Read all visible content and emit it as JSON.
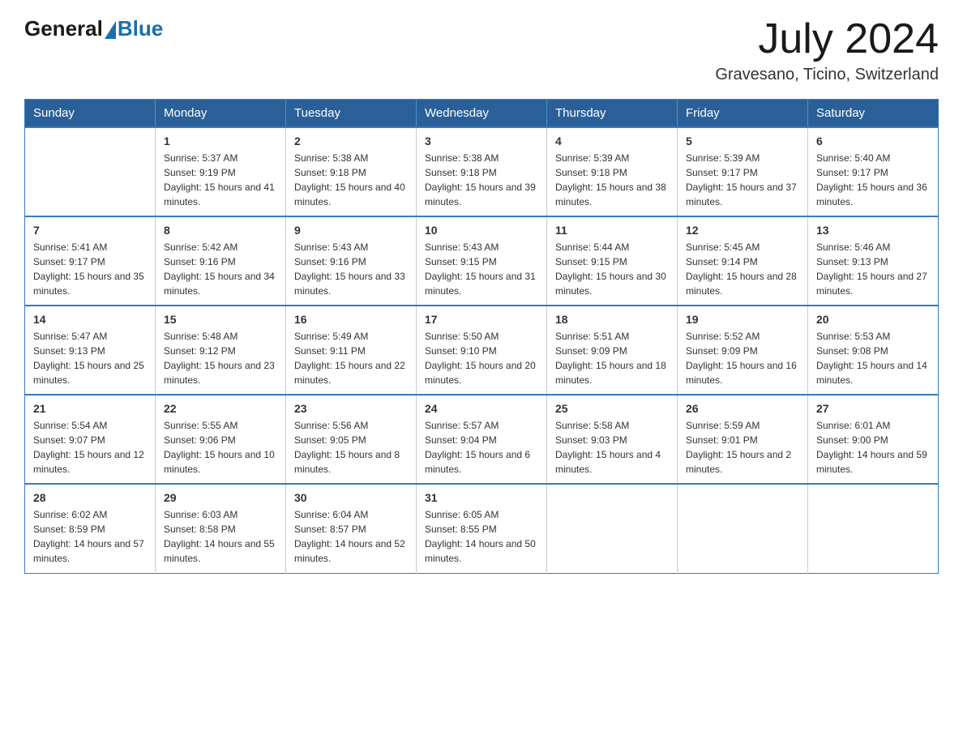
{
  "header": {
    "logo_general": "General",
    "logo_blue": "Blue",
    "main_title": "July 2024",
    "subtitle": "Gravesano, Ticino, Switzerland"
  },
  "weekdays": [
    "Sunday",
    "Monday",
    "Tuesday",
    "Wednesday",
    "Thursday",
    "Friday",
    "Saturday"
  ],
  "weeks": [
    [
      {
        "day": "",
        "sunrise": "",
        "sunset": "",
        "daylight": ""
      },
      {
        "day": "1",
        "sunrise": "Sunrise: 5:37 AM",
        "sunset": "Sunset: 9:19 PM",
        "daylight": "Daylight: 15 hours and 41 minutes."
      },
      {
        "day": "2",
        "sunrise": "Sunrise: 5:38 AM",
        "sunset": "Sunset: 9:18 PM",
        "daylight": "Daylight: 15 hours and 40 minutes."
      },
      {
        "day": "3",
        "sunrise": "Sunrise: 5:38 AM",
        "sunset": "Sunset: 9:18 PM",
        "daylight": "Daylight: 15 hours and 39 minutes."
      },
      {
        "day": "4",
        "sunrise": "Sunrise: 5:39 AM",
        "sunset": "Sunset: 9:18 PM",
        "daylight": "Daylight: 15 hours and 38 minutes."
      },
      {
        "day": "5",
        "sunrise": "Sunrise: 5:39 AM",
        "sunset": "Sunset: 9:17 PM",
        "daylight": "Daylight: 15 hours and 37 minutes."
      },
      {
        "day": "6",
        "sunrise": "Sunrise: 5:40 AM",
        "sunset": "Sunset: 9:17 PM",
        "daylight": "Daylight: 15 hours and 36 minutes."
      }
    ],
    [
      {
        "day": "7",
        "sunrise": "Sunrise: 5:41 AM",
        "sunset": "Sunset: 9:17 PM",
        "daylight": "Daylight: 15 hours and 35 minutes."
      },
      {
        "day": "8",
        "sunrise": "Sunrise: 5:42 AM",
        "sunset": "Sunset: 9:16 PM",
        "daylight": "Daylight: 15 hours and 34 minutes."
      },
      {
        "day": "9",
        "sunrise": "Sunrise: 5:43 AM",
        "sunset": "Sunset: 9:16 PM",
        "daylight": "Daylight: 15 hours and 33 minutes."
      },
      {
        "day": "10",
        "sunrise": "Sunrise: 5:43 AM",
        "sunset": "Sunset: 9:15 PM",
        "daylight": "Daylight: 15 hours and 31 minutes."
      },
      {
        "day": "11",
        "sunrise": "Sunrise: 5:44 AM",
        "sunset": "Sunset: 9:15 PM",
        "daylight": "Daylight: 15 hours and 30 minutes."
      },
      {
        "day": "12",
        "sunrise": "Sunrise: 5:45 AM",
        "sunset": "Sunset: 9:14 PM",
        "daylight": "Daylight: 15 hours and 28 minutes."
      },
      {
        "day": "13",
        "sunrise": "Sunrise: 5:46 AM",
        "sunset": "Sunset: 9:13 PM",
        "daylight": "Daylight: 15 hours and 27 minutes."
      }
    ],
    [
      {
        "day": "14",
        "sunrise": "Sunrise: 5:47 AM",
        "sunset": "Sunset: 9:13 PM",
        "daylight": "Daylight: 15 hours and 25 minutes."
      },
      {
        "day": "15",
        "sunrise": "Sunrise: 5:48 AM",
        "sunset": "Sunset: 9:12 PM",
        "daylight": "Daylight: 15 hours and 23 minutes."
      },
      {
        "day": "16",
        "sunrise": "Sunrise: 5:49 AM",
        "sunset": "Sunset: 9:11 PM",
        "daylight": "Daylight: 15 hours and 22 minutes."
      },
      {
        "day": "17",
        "sunrise": "Sunrise: 5:50 AM",
        "sunset": "Sunset: 9:10 PM",
        "daylight": "Daylight: 15 hours and 20 minutes."
      },
      {
        "day": "18",
        "sunrise": "Sunrise: 5:51 AM",
        "sunset": "Sunset: 9:09 PM",
        "daylight": "Daylight: 15 hours and 18 minutes."
      },
      {
        "day": "19",
        "sunrise": "Sunrise: 5:52 AM",
        "sunset": "Sunset: 9:09 PM",
        "daylight": "Daylight: 15 hours and 16 minutes."
      },
      {
        "day": "20",
        "sunrise": "Sunrise: 5:53 AM",
        "sunset": "Sunset: 9:08 PM",
        "daylight": "Daylight: 15 hours and 14 minutes."
      }
    ],
    [
      {
        "day": "21",
        "sunrise": "Sunrise: 5:54 AM",
        "sunset": "Sunset: 9:07 PM",
        "daylight": "Daylight: 15 hours and 12 minutes."
      },
      {
        "day": "22",
        "sunrise": "Sunrise: 5:55 AM",
        "sunset": "Sunset: 9:06 PM",
        "daylight": "Daylight: 15 hours and 10 minutes."
      },
      {
        "day": "23",
        "sunrise": "Sunrise: 5:56 AM",
        "sunset": "Sunset: 9:05 PM",
        "daylight": "Daylight: 15 hours and 8 minutes."
      },
      {
        "day": "24",
        "sunrise": "Sunrise: 5:57 AM",
        "sunset": "Sunset: 9:04 PM",
        "daylight": "Daylight: 15 hours and 6 minutes."
      },
      {
        "day": "25",
        "sunrise": "Sunrise: 5:58 AM",
        "sunset": "Sunset: 9:03 PM",
        "daylight": "Daylight: 15 hours and 4 minutes."
      },
      {
        "day": "26",
        "sunrise": "Sunrise: 5:59 AM",
        "sunset": "Sunset: 9:01 PM",
        "daylight": "Daylight: 15 hours and 2 minutes."
      },
      {
        "day": "27",
        "sunrise": "Sunrise: 6:01 AM",
        "sunset": "Sunset: 9:00 PM",
        "daylight": "Daylight: 14 hours and 59 minutes."
      }
    ],
    [
      {
        "day": "28",
        "sunrise": "Sunrise: 6:02 AM",
        "sunset": "Sunset: 8:59 PM",
        "daylight": "Daylight: 14 hours and 57 minutes."
      },
      {
        "day": "29",
        "sunrise": "Sunrise: 6:03 AM",
        "sunset": "Sunset: 8:58 PM",
        "daylight": "Daylight: 14 hours and 55 minutes."
      },
      {
        "day": "30",
        "sunrise": "Sunrise: 6:04 AM",
        "sunset": "Sunset: 8:57 PM",
        "daylight": "Daylight: 14 hours and 52 minutes."
      },
      {
        "day": "31",
        "sunrise": "Sunrise: 6:05 AM",
        "sunset": "Sunset: 8:55 PM",
        "daylight": "Daylight: 14 hours and 50 minutes."
      },
      {
        "day": "",
        "sunrise": "",
        "sunset": "",
        "daylight": ""
      },
      {
        "day": "",
        "sunrise": "",
        "sunset": "",
        "daylight": ""
      },
      {
        "day": "",
        "sunrise": "",
        "sunset": "",
        "daylight": ""
      }
    ]
  ]
}
